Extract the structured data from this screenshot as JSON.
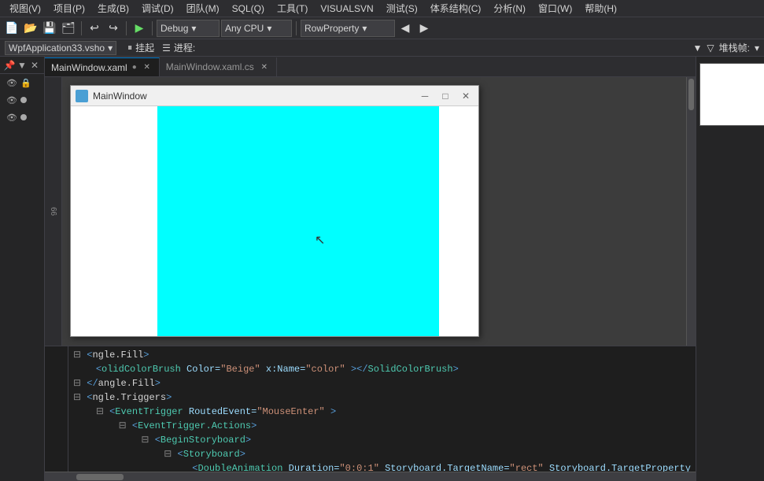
{
  "menu": {
    "items": [
      "视图(V)",
      "项目(P)",
      "生成(B)",
      "调试(D)",
      "团队(M)",
      "SQL(Q)",
      "工具(T)",
      "VISUALSVN",
      "测试(S)",
      "体系结构(C)",
      "分析(N)",
      "窗口(W)",
      "帮助(H)"
    ]
  },
  "toolbar": {
    "config_label": "Debug",
    "platform_label": "Any CPU",
    "property_label": "RowProperty",
    "undo_btn": "↩",
    "redo_btn": "↪",
    "run_btn": "▶",
    "pause_btn": "⏸",
    "stop_btn": "⏹"
  },
  "project_bar": {
    "project_name": "WpfApplication33.vsho",
    "hang_label": "挂起",
    "thread_label": "进程:",
    "filter_label": "堆栈帧:"
  },
  "tabs": [
    {
      "label": "MainWindow.xaml",
      "active": true,
      "modified": true
    },
    {
      "label": "MainWindow.xaml.cs",
      "active": false,
      "modified": false
    }
  ],
  "sidebar": {
    "items": [
      {
        "icon": "eye",
        "lock": true,
        "dot": false
      },
      {
        "icon": "eye",
        "lock": false,
        "dot": true
      },
      {
        "icon": "eye",
        "lock": false,
        "dot": true
      }
    ]
  },
  "wpf_window": {
    "title": "MainWindow",
    "icon": "▣",
    "min_btn": "─",
    "max_btn": "□",
    "close_btn": "✕"
  },
  "code": {
    "lines": [
      {
        "num": "",
        "content": "angle.Fill>",
        "type": "plain"
      },
      {
        "num": "",
        "content": "    <SolidColorBrush Color=\"Beige\" x:Name=\"color\"></SolidColorBrush>",
        "type": "tag"
      },
      {
        "num": "",
        "content": "angle.Fill>",
        "type": "plain"
      },
      {
        "num": "",
        "content": "<angle.Triggers>",
        "type": "plain"
      },
      {
        "num": "",
        "content": "    <EventTrigger RoutedEvent=\"MouseEnter\">",
        "type": "tag"
      },
      {
        "num": "",
        "content": "        <EventTrigger.Actions>",
        "type": "tag"
      },
      {
        "num": "",
        "content": "            <BeginStoryboard>",
        "type": "tag"
      },
      {
        "num": "",
        "content": "                <Storyboard>",
        "type": "tag"
      },
      {
        "num": "",
        "content": "                    <DoubleAnimation Duration=\"0:0:1\" Storyboard.TargetName=\"rect\" Storyboard.TargetProperty",
        "type": "tag"
      }
    ]
  },
  "ruler_number": "66",
  "colors": {
    "accent": "#007acc",
    "bg_dark": "#1e1e1e",
    "bg_mid": "#2d2d30",
    "bg_light": "#252526",
    "cyan_fill": "#00ffff",
    "border": "#3f3f46"
  }
}
